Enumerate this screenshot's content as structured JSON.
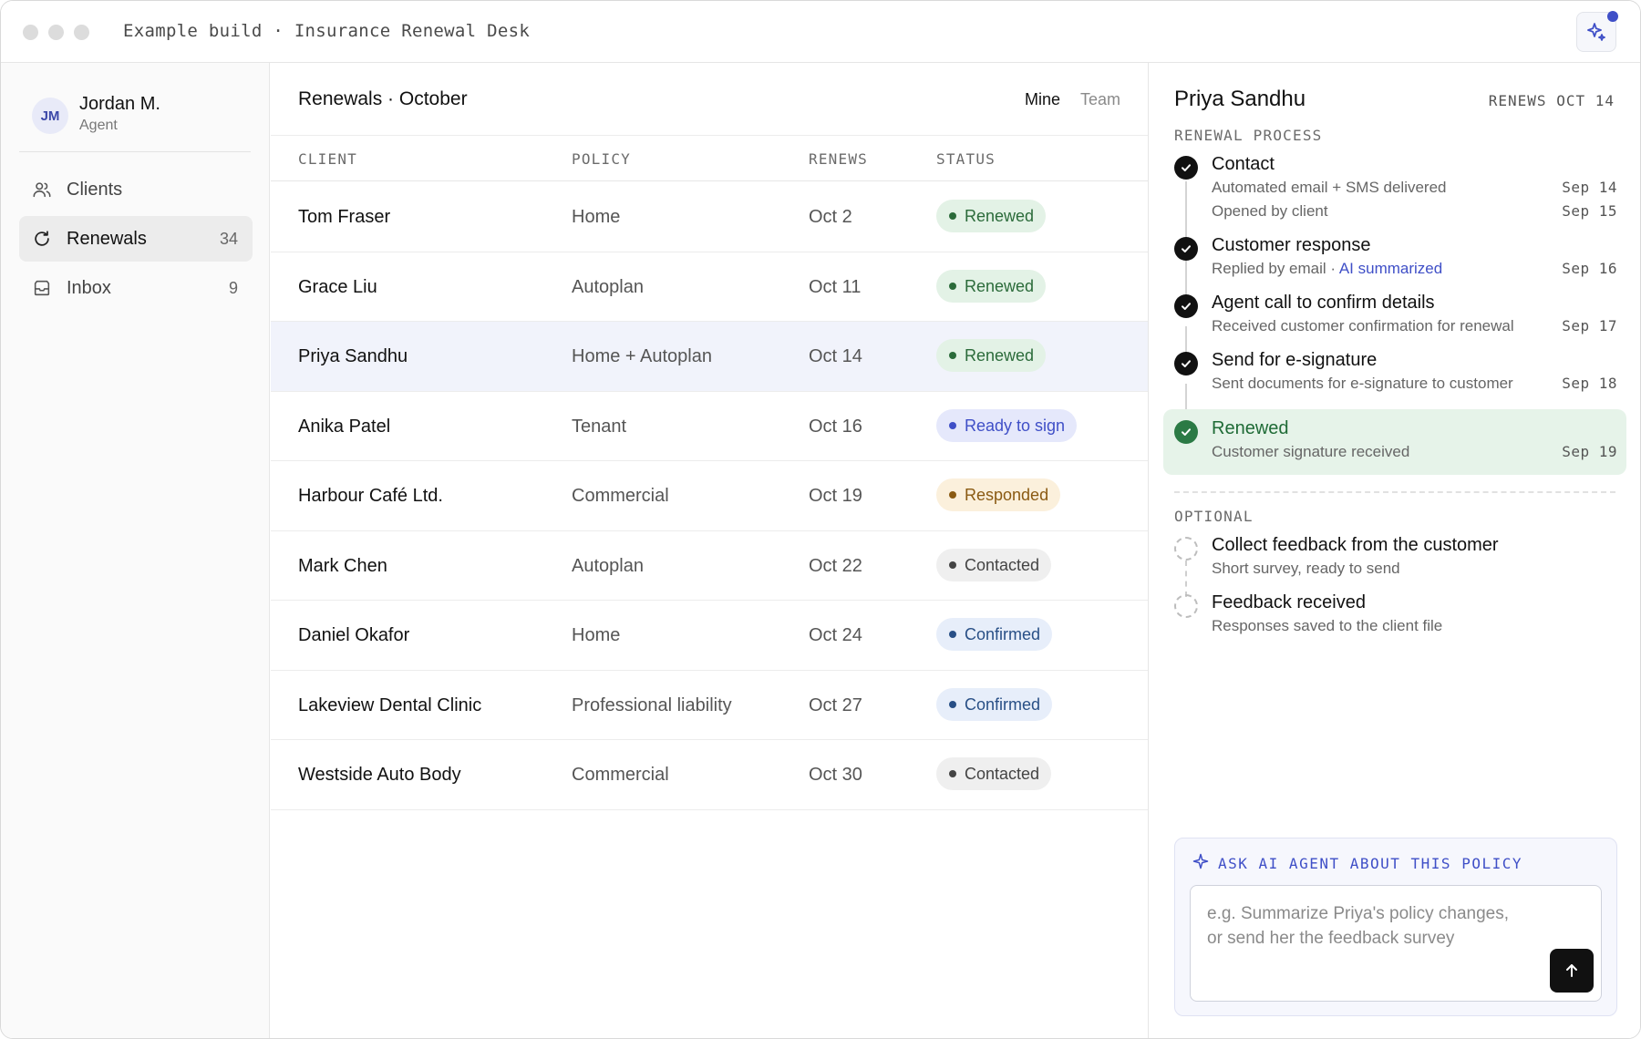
{
  "window": {
    "title": "Example build · Insurance Renewal Desk",
    "accent_color": "#3f4fc7"
  },
  "user": {
    "initials": "JM",
    "name": "Jordan M.",
    "role": "Agent"
  },
  "sidebar": {
    "items": [
      {
        "label": "Clients",
        "icon": "users-icon",
        "count": "",
        "active": false
      },
      {
        "label": "Renewals",
        "icon": "refresh-icon",
        "count": "34",
        "active": true
      },
      {
        "label": "Inbox",
        "icon": "inbox-icon",
        "count": "9",
        "active": false
      }
    ]
  },
  "list": {
    "title": "Renewals · October",
    "toggle": {
      "mine": "Mine",
      "team": "Team",
      "selected": "Mine"
    },
    "columns": {
      "client": "CLIENT",
      "policy": "POLICY",
      "renews": "RENEWS",
      "status": "STATUS"
    },
    "rows": [
      {
        "client": "Tom Fraser",
        "policy": "Home",
        "renews": "Oct 2",
        "status": "Renewed",
        "status_type": "renewed"
      },
      {
        "client": "Grace Liu",
        "policy": "Autoplan",
        "renews": "Oct 11",
        "status": "Renewed",
        "status_type": "renewed"
      },
      {
        "client": "Priya Sandhu",
        "policy": "Home + Autoplan",
        "renews": "Oct 14",
        "status": "Renewed",
        "status_type": "renewed",
        "selected": true
      },
      {
        "client": "Anika Patel",
        "policy": "Tenant",
        "renews": "Oct 16",
        "status": "Ready to sign",
        "status_type": "ready"
      },
      {
        "client": "Harbour Café Ltd.",
        "policy": "Commercial",
        "renews": "Oct 19",
        "status": "Responded",
        "status_type": "responded"
      },
      {
        "client": "Mark Chen",
        "policy": "Autoplan",
        "renews": "Oct 22",
        "status": "Contacted",
        "status_type": "contacted"
      },
      {
        "client": "Daniel Okafor",
        "policy": "Home",
        "renews": "Oct 24",
        "status": "Confirmed",
        "status_type": "confirmed"
      },
      {
        "client": "Lakeview Dental Clinic",
        "policy": "Professional liability",
        "renews": "Oct 27",
        "status": "Confirmed",
        "status_type": "confirmed"
      },
      {
        "client": "Westside Auto Body",
        "policy": "Commercial",
        "renews": "Oct 30",
        "status": "Contacted",
        "status_type": "contacted"
      }
    ]
  },
  "detail": {
    "name": "Priya Sandhu",
    "renews": "RENEWS OCT 14",
    "process_label": "RENEWAL PROCESS",
    "steps": [
      {
        "title": "Contact",
        "sub1": "Automated email + SMS delivered",
        "date1": "Sep 14",
        "sub2": "Opened by client",
        "date2": "Sep 15"
      },
      {
        "title": "Customer response",
        "sub1": "Replied by email · ",
        "sub1_link": "AI summarized",
        "date1": "Sep 16"
      },
      {
        "title": "Agent call to confirm details",
        "sub1": "Received customer confirmation for renewal",
        "date1": "Sep 17"
      },
      {
        "title": "Send for e-signature",
        "sub1": "Sent documents for e-signature to customer",
        "date1": "Sep 18"
      },
      {
        "title": "Renewed",
        "sub1": "Customer signature received",
        "date1": "Sep 19"
      }
    ],
    "optional_label": "OPTIONAL",
    "optional_steps": [
      {
        "title": "Collect feedback from the customer",
        "sub1": "Short survey, ready to send"
      },
      {
        "title": "Feedback received",
        "sub1": "Responses saved to the client file"
      }
    ],
    "ask": {
      "label": "ASK AI AGENT ABOUT THIS POLICY",
      "placeholder": "e.g. Summarize Priya's policy changes,\nor send her the feedback survey",
      "send_icon": "arrow-up-icon"
    }
  }
}
